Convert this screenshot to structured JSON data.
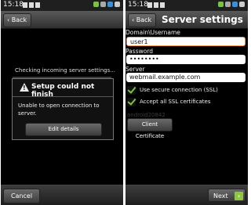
{
  "status_bar": {
    "time": "15:18"
  },
  "screen1": {
    "back_label": "Back",
    "checking_text": "Checking incoming server settings...",
    "dialog": {
      "title": "Setup could not finish",
      "message": "Unable to open connection to server.",
      "button_label": "Edit details"
    },
    "cancel_label": "Cancel"
  },
  "screen2": {
    "back_label": "Back",
    "title": "Server settings",
    "domain_label": "Domain\\Username",
    "domain_value": "user1",
    "password_label": "Password",
    "password_value": "••••••••",
    "server_label": "Server",
    "server_value": "webmail.example.com",
    "ssl_label": "Use secure connection (SSL)",
    "ssl_checked": true,
    "all_certs_label": "Accept all SSL certificates",
    "all_certs_checked": true,
    "device_id": "android20842",
    "client_cert_label": "Client Certificate",
    "next_label": "Next"
  },
  "colors": {
    "accent_green": "#8dc63f",
    "focus_orange": "#f59a3c"
  }
}
